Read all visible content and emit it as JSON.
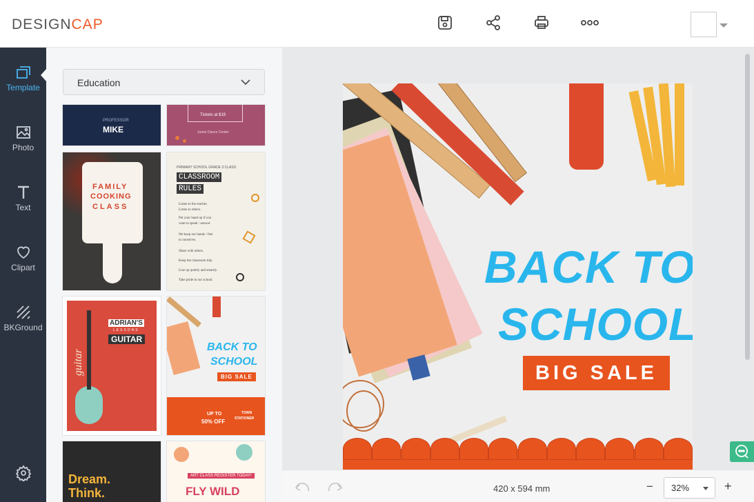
{
  "app": {
    "logo_prefix": "DESIGN",
    "logo_accent": "CAP"
  },
  "toolbar": {
    "icons": [
      "save-icon",
      "share-icon",
      "print-icon",
      "more-icon"
    ]
  },
  "sidebar": {
    "items": [
      {
        "label": "Template",
        "icon": "template-icon",
        "active": true
      },
      {
        "label": "Photo",
        "icon": "photo-icon"
      },
      {
        "label": "Text",
        "icon": "text-icon"
      },
      {
        "label": "Clipart",
        "icon": "heart-icon"
      },
      {
        "label": "BKGround",
        "icon": "background-icon"
      }
    ],
    "settings_icon": "gear-icon"
  },
  "panel": {
    "category": "Education",
    "templates": [
      {
        "name": "professor-mike",
        "text": [
          "PROFESSOR",
          "MIKE"
        ]
      },
      {
        "name": "dance-tickets",
        "text": [
          "Tickets at $19",
          "Junior Dance Center"
        ]
      },
      {
        "name": "family-cooking-class",
        "text": [
          "FAMILY",
          "COOKING",
          "CLASS"
        ]
      },
      {
        "name": "classroom-rules",
        "text": [
          "PRIMARY SCHOOL GRADE 3 CLASS",
          "CLASSROOM",
          "RULES",
          "Listen to the teacher.",
          "Listen to others.",
          "Put your hand up if you",
          "want to speak / answer.",
          "We keep our hands / feet",
          "to ourselves.",
          "Share with others.",
          "Keep the classroom tidy.",
          "Line up quietly and smartly.",
          "Take pride in our school."
        ]
      },
      {
        "name": "adrians-guitar",
        "text": [
          "ADRIAN'S",
          "LESSONS",
          "GUITAR",
          "guitar"
        ]
      },
      {
        "name": "back-to-school-thumb",
        "text": [
          "BACK TO",
          "SCHOOL",
          "BIG SALE",
          "UP TO",
          "50% OFF",
          "TOWN",
          "STATIONER"
        ]
      },
      {
        "name": "dream-think",
        "text": [
          "Dream.",
          "Think."
        ]
      },
      {
        "name": "fly-wild",
        "text": [
          "ART CLASS REGISTER TODAY!",
          "FLY WILD"
        ]
      }
    ]
  },
  "poster": {
    "line1": "BACK TO",
    "line2": "SCHOOL",
    "badge": "BIG SALE",
    "accent": "#e8541e",
    "title_color": "#29b6ec"
  },
  "bottom": {
    "size": "420 x 594 mm",
    "zoom": "32%",
    "minus": "−",
    "plus": "+"
  },
  "colors": {
    "sidebar": "#2c3340",
    "active": "#4ab6f0",
    "accent": "#f05a28",
    "chat": "#3cba8a"
  }
}
